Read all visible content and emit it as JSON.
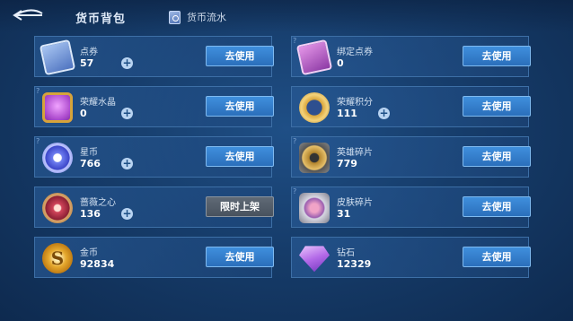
{
  "header": {
    "title": "货币背包",
    "flow_label": "货币流水"
  },
  "cards": [
    {
      "name": "点券",
      "value": "57",
      "button": "去使用",
      "has_plus": true,
      "icon": "ticket-icon"
    },
    {
      "name": "绑定点券",
      "value": "0",
      "button": "去使用",
      "has_plus": false,
      "icon": "bound-ticket-icon"
    },
    {
      "name": "荣耀水晶",
      "value": "0",
      "button": "去使用",
      "has_plus": true,
      "icon": "crystal-icon"
    },
    {
      "name": "荣耀积分",
      "value": "111",
      "button": "去使用",
      "has_plus": true,
      "icon": "honor-points-icon"
    },
    {
      "name": "星币",
      "value": "766",
      "button": "去使用",
      "has_plus": true,
      "icon": "star-coin-icon"
    },
    {
      "name": "英雄碎片",
      "value": "779",
      "button": "去使用",
      "has_plus": false,
      "icon": "hero-fragment-icon"
    },
    {
      "name": "蔷薇之心",
      "value": "136",
      "button": "限时上架",
      "has_plus": true,
      "icon": "rose-heart-icon"
    },
    {
      "name": "皮肤碎片",
      "value": "31",
      "button": "去使用",
      "has_plus": false,
      "icon": "skin-fragment-icon"
    },
    {
      "name": "金币",
      "value": "92834",
      "button": "去使用",
      "has_plus": false,
      "icon": "gold-coin-icon"
    },
    {
      "name": "钻石",
      "value": "12329",
      "button": "去使用",
      "has_plus": false,
      "icon": "diamond-icon"
    }
  ]
}
